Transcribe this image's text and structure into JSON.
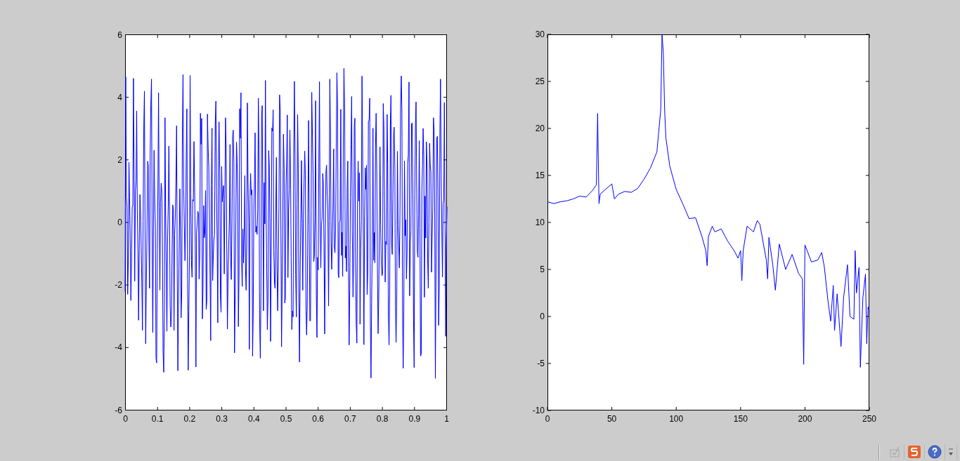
{
  "left_plot": {
    "kind": "waveform",
    "xtick_labels": [
      "0",
      "0.1",
      "0.2",
      "0.3",
      "0.4",
      "0.5",
      "0.6",
      "0.7",
      "0.8",
      "0.9",
      "1"
    ],
    "ytick_labels": [
      "6",
      "4",
      "2",
      "0",
      "-2",
      "-4",
      "-6"
    ]
  },
  "right_plot": {
    "chart_data": {
      "type": "line",
      "xlim": [
        0,
        250
      ],
      "ylim": [
        -10,
        30
      ],
      "xticks": [
        0,
        50,
        100,
        150,
        200,
        250
      ],
      "yticks": [
        -10,
        -5,
        0,
        5,
        10,
        15,
        20,
        25,
        30
      ],
      "x": [
        0,
        5,
        10,
        15,
        20,
        25,
        30,
        35,
        38,
        39,
        40,
        41,
        45,
        50,
        52,
        55,
        60,
        65,
        70,
        75,
        80,
        85,
        88,
        89,
        90,
        91,
        92,
        95,
        100,
        105,
        110,
        115,
        120,
        123,
        124,
        125,
        128,
        130,
        135,
        140,
        145,
        148,
        150,
        151,
        152,
        155,
        160,
        163,
        165,
        170,
        171,
        172,
        175,
        177,
        180,
        185,
        190,
        195,
        198,
        199,
        200,
        205,
        210,
        213,
        215,
        218,
        220,
        222,
        223,
        225,
        228,
        230,
        233,
        235,
        238,
        239,
        240,
        242,
        243,
        245,
        247,
        248,
        249,
        250
      ],
      "series": [
        {
          "color": "#0000ff",
          "values": [
            12.2,
            12.0,
            12.2,
            12.3,
            12.5,
            12.8,
            12.7,
            13.4,
            14,
            21.6,
            12.0,
            13.0,
            13.5,
            14.1,
            12.5,
            13.0,
            13.3,
            13.2,
            13.6,
            14.6,
            15.8,
            17.5,
            22,
            30,
            28,
            22,
            19,
            16,
            13.5,
            12,
            10.4,
            10.5,
            8.5,
            7,
            5.4,
            8.5,
            9.6,
            9.0,
            9.3,
            8.0,
            7.0,
            6.2,
            7.0,
            3.8,
            7.0,
            9.6,
            9.0,
            10.2,
            9.8,
            6.0,
            4.0,
            8.4,
            5.5,
            2.8,
            7.7,
            5.0,
            6.6,
            4.6,
            4.0,
            -5.1,
            7.6,
            5.8,
            6.0,
            6.8,
            5.3,
            1.5,
            -0.5,
            3.3,
            -1.5,
            2.4,
            -3.2,
            2.0,
            5.5,
            0.0,
            -0.3,
            7.0,
            2.5,
            5.2,
            -5.4,
            2.0,
            4.5,
            -2.9,
            1.0,
            0.5
          ]
        }
      ]
    }
  },
  "toolbar": {
    "items": [
      {
        "kind": "check"
      },
      {
        "kind": "s-logo"
      },
      {
        "kind": "help"
      },
      {
        "kind": "more"
      }
    ]
  }
}
